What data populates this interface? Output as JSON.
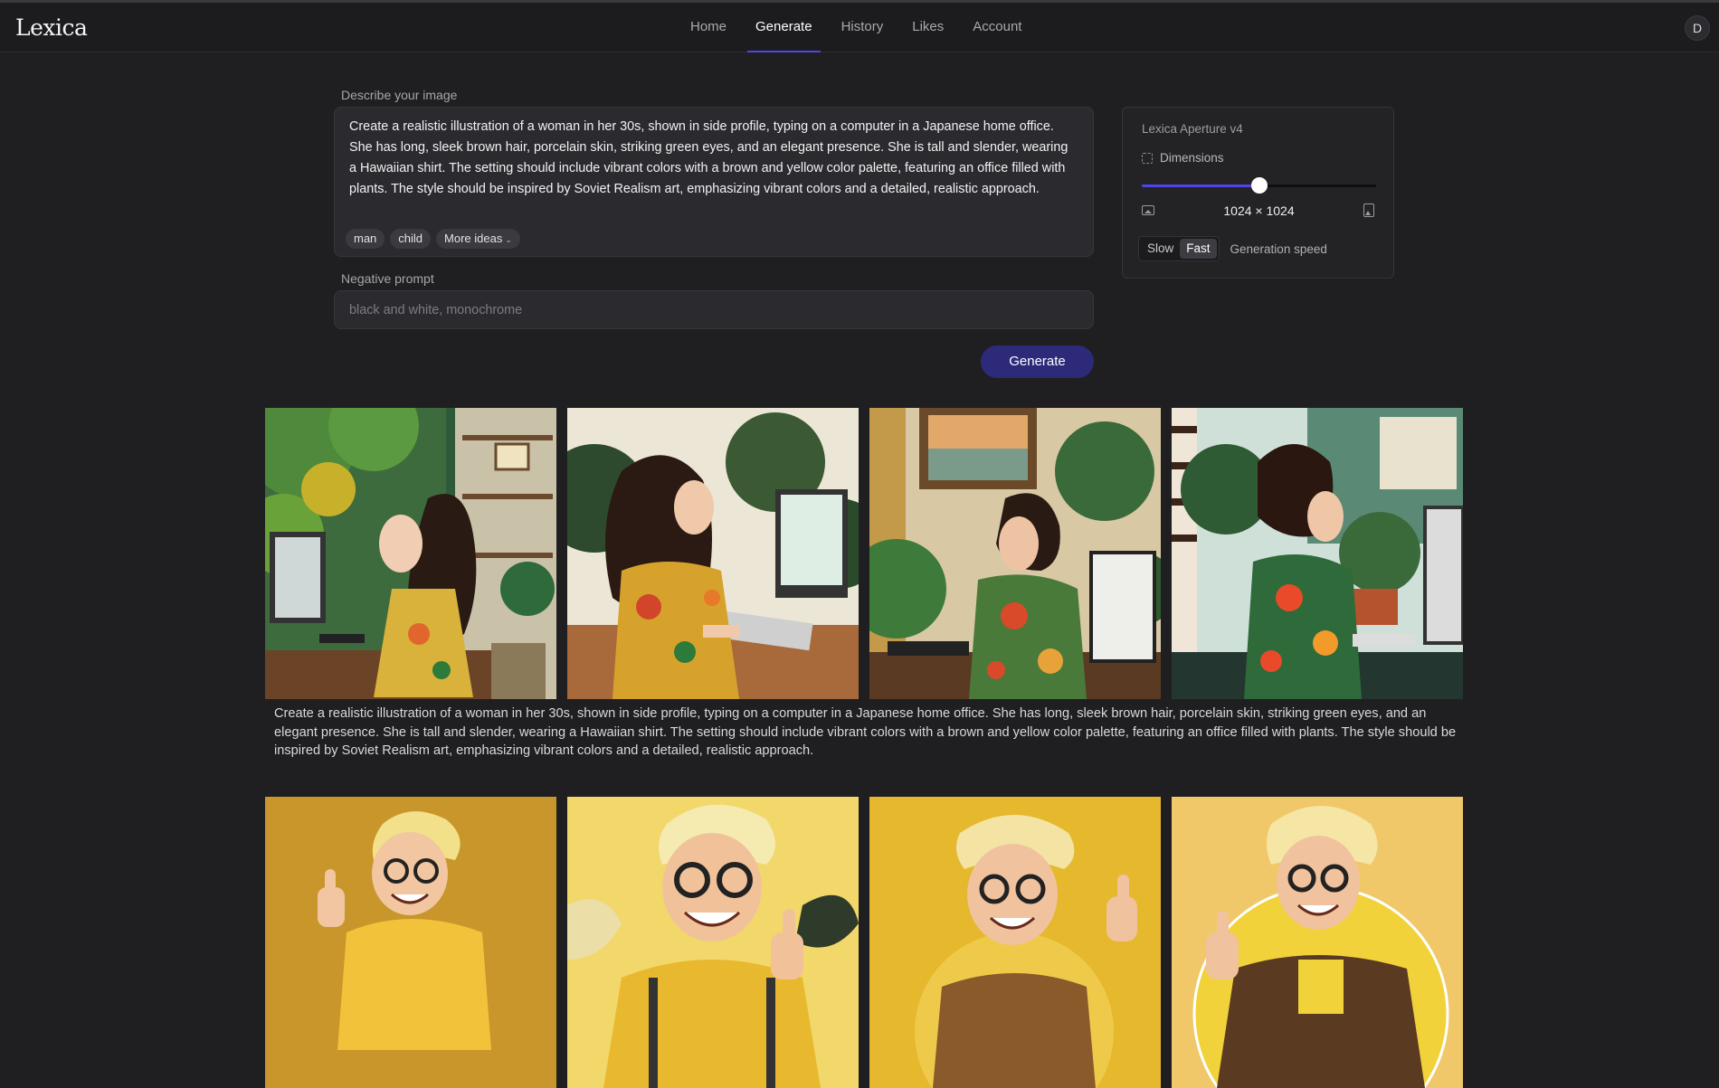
{
  "app": {
    "logo": "Lexica"
  },
  "nav": {
    "items": [
      {
        "label": "Home",
        "active": false
      },
      {
        "label": "Generate",
        "active": true
      },
      {
        "label": "History",
        "active": false
      },
      {
        "label": "Likes",
        "active": false
      },
      {
        "label": "Account",
        "active": false
      }
    ],
    "avatar_initial": "D"
  },
  "prompt": {
    "label": "Describe your image",
    "value": "Create a realistic illustration of a woman in her 30s, shown in side profile, typing on a computer in a Japanese home office. She has long, sleek brown hair, porcelain skin, striking green eyes, and an elegant presence. She is tall and slender, wearing a Hawaiian shirt. The setting should include vibrant colors with a brown and yellow color palette, featuring an office filled with plants. The style should be inspired by Soviet Realism art, emphasizing vibrant colors and a detailed, realistic approach.",
    "chips": [
      "man",
      "child"
    ],
    "more_ideas": "More ideas"
  },
  "negative": {
    "label": "Negative prompt",
    "placeholder": "black and white, monochrome",
    "value": ""
  },
  "generate_button": "Generate",
  "settings": {
    "model": "Lexica Aperture v4",
    "dimensions_label": "Dimensions",
    "dimensions_value": "1024 × 1024",
    "aspect_slider_fraction": 0.5,
    "speed_options": [
      "Slow",
      "Fast"
    ],
    "speed_selected": "Fast",
    "speed_label": "Generation speed",
    "accent_color": "#4f46e5"
  },
  "results": [
    {
      "caption": "Create a realistic illustration of a woman in her 30s, shown in side profile, typing on a computer in a Japanese home office. She has long, sleek brown hair, porcelain skin, striking green eyes, and an elegant presence. She is tall and slender, wearing a Hawaiian shirt. The setting should include vibrant colors with a brown and yellow color palette, featuring an office filled with plants. The style should be inspired by Soviet Realism art, emphasizing vibrant colors and a detailed, realistic approach.",
      "images": [
        "woman-office-1",
        "woman-office-2",
        "woman-office-3",
        "woman-office-4"
      ]
    },
    {
      "caption": "",
      "images": [
        "blond-man-thumbs-up-1",
        "blond-man-thumbs-up-2",
        "blond-man-thumbs-up-3",
        "blond-man-thumbs-up-4"
      ]
    }
  ]
}
